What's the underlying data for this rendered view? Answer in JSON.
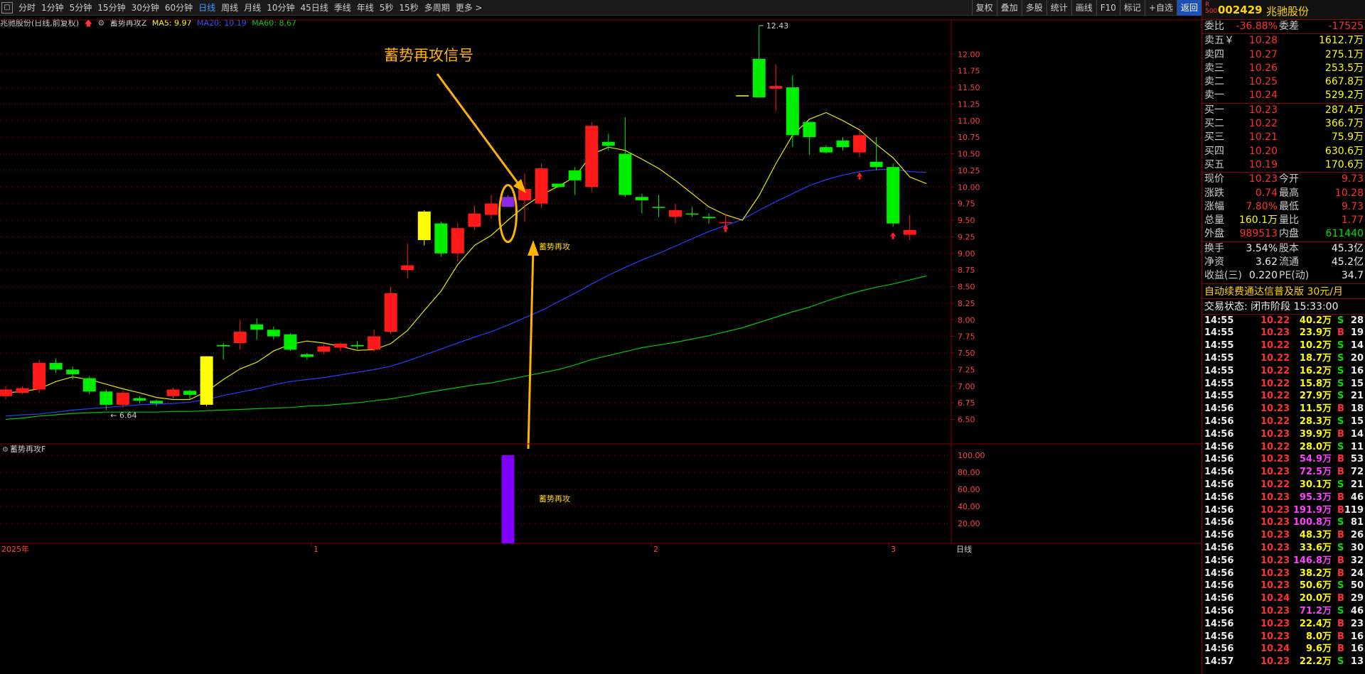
{
  "toolbar": {
    "menu_icon": "▢",
    "periods": [
      "分时",
      "1分钟",
      "5分钟",
      "15分钟",
      "30分钟",
      "60分钟",
      "日线",
      "周线",
      "月线",
      "10分钟",
      "45日线",
      "季线",
      "年线",
      "5秒",
      "15秒",
      "多周期",
      "更多 >"
    ],
    "active_period": "日线",
    "right_buttons": [
      "复权",
      "叠加",
      "多股",
      "统计",
      "画线",
      "F10",
      "标记",
      "+自选",
      "返回"
    ]
  },
  "info": {
    "title": "兆驰股份(日线,前复权)",
    "indicator": "蓄势再攻Z",
    "ma5": "MA5: 9.97",
    "ma20": "MA20: 10.19",
    "ma60": "MA60: 8.67"
  },
  "annotation": {
    "title": "蓄势再攻信号",
    "label": "蓄势再攻"
  },
  "sub_panel": {
    "title": "蓄势再攻F",
    "label": "蓄势再攻"
  },
  "bottom_axis": {
    "year": "2025年",
    "months": [
      "1",
      "2",
      "3"
    ],
    "period": "日线"
  },
  "chart_data": [
    {
      "type": "candlestick",
      "title": "兆驰股份(日线,前复权)",
      "y_ticks": [
        6.5,
        6.75,
        7.0,
        7.25,
        7.5,
        7.75,
        8.0,
        8.25,
        8.5,
        8.75,
        9.0,
        9.25,
        9.5,
        9.75,
        10.0,
        10.25,
        10.5,
        10.75,
        11.0,
        11.25,
        11.5,
        11.75,
        12.0
      ],
      "ylim": [
        6.25,
        12.6
      ],
      "max_label": "12.43",
      "min_label": "6.64",
      "candles": [
        [
          6.85,
          6.95,
          6.8,
          7.0,
          "red"
        ],
        [
          6.9,
          6.97,
          6.88,
          7.0,
          "red"
        ],
        [
          6.95,
          7.35,
          6.9,
          7.4,
          "red"
        ],
        [
          7.35,
          7.25,
          7.2,
          7.42,
          "green"
        ],
        [
          7.25,
          7.18,
          7.1,
          7.3,
          "green"
        ],
        [
          7.12,
          6.92,
          6.88,
          7.15,
          "green"
        ],
        [
          6.92,
          6.72,
          6.64,
          6.95,
          "green"
        ],
        [
          6.72,
          6.9,
          6.68,
          6.93,
          "red"
        ],
        [
          6.82,
          6.78,
          6.74,
          6.85,
          "green"
        ],
        [
          6.78,
          6.74,
          6.7,
          6.8,
          "green"
        ],
        [
          6.85,
          6.95,
          6.82,
          6.98,
          "red"
        ],
        [
          6.93,
          6.87,
          6.81,
          6.95,
          "green"
        ],
        [
          6.72,
          7.45,
          6.7,
          7.45,
          "yellow"
        ],
        [
          7.6,
          7.62,
          7.4,
          7.65,
          "green"
        ],
        [
          7.65,
          7.82,
          7.55,
          8.0,
          "red"
        ],
        [
          7.93,
          7.85,
          7.7,
          8.02,
          "green"
        ],
        [
          7.85,
          7.75,
          7.7,
          7.9,
          "green"
        ],
        [
          7.78,
          7.55,
          7.53,
          7.8,
          "green"
        ],
        [
          7.48,
          7.44,
          7.4,
          7.5,
          "green"
        ],
        [
          7.52,
          7.6,
          7.48,
          7.63,
          "red"
        ],
        [
          7.58,
          7.64,
          7.53,
          7.66,
          "red"
        ],
        [
          7.62,
          7.6,
          7.56,
          7.68,
          "green"
        ],
        [
          7.55,
          7.75,
          7.52,
          7.85,
          "red"
        ],
        [
          7.82,
          8.4,
          7.78,
          8.5,
          "red"
        ],
        [
          8.75,
          8.82,
          8.62,
          9.15,
          "red"
        ],
        [
          9.2,
          9.63,
          9.12,
          9.65,
          "yellow"
        ],
        [
          9.45,
          9.0,
          8.95,
          9.48,
          "green"
        ],
        [
          9.0,
          9.38,
          8.88,
          9.45,
          "red"
        ],
        [
          9.4,
          9.6,
          9.35,
          9.72,
          "red"
        ],
        [
          9.58,
          9.75,
          9.52,
          9.88,
          "red"
        ],
        [
          9.85,
          9.7,
          9.7,
          9.88,
          "purple"
        ],
        [
          9.8,
          9.97,
          9.48,
          10.2,
          "red"
        ],
        [
          9.75,
          10.28,
          9.68,
          10.35,
          "red"
        ],
        [
          10.05,
          10.0,
          9.98,
          10.05,
          "green"
        ],
        [
          10.1,
          10.25,
          9.88,
          10.3,
          "green"
        ],
        [
          10.0,
          10.92,
          9.92,
          10.98,
          "red"
        ],
        [
          10.68,
          10.62,
          10.55,
          10.8,
          "green"
        ],
        [
          10.5,
          9.88,
          9.85,
          11.05,
          "green"
        ],
        [
          9.85,
          9.8,
          9.6,
          9.9,
          "green"
        ],
        [
          9.7,
          9.7,
          9.55,
          9.88,
          "green"
        ],
        [
          9.55,
          9.65,
          9.45,
          9.75,
          "red"
        ],
        [
          9.6,
          9.6,
          9.55,
          9.7,
          "green"
        ],
        [
          9.53,
          9.55,
          9.45,
          9.6,
          "green"
        ],
        [
          9.47,
          9.47,
          9.4,
          9.6,
          "red"
        ],
        [
          11.38,
          11.38,
          11.38,
          11.38,
          "yellow"
        ],
        [
          11.35,
          11.93,
          11.35,
          12.43,
          "green"
        ],
        [
          11.52,
          11.48,
          11.15,
          11.85,
          "red"
        ],
        [
          11.5,
          10.78,
          10.6,
          11.68,
          "green"
        ],
        [
          10.98,
          10.75,
          10.48,
          10.98,
          "green"
        ],
        [
          10.52,
          10.6,
          10.5,
          10.63,
          "green"
        ],
        [
          10.6,
          10.7,
          10.55,
          10.75,
          "green"
        ],
        [
          10.78,
          10.52,
          10.45,
          10.85,
          "red"
        ],
        [
          10.38,
          10.3,
          10.25,
          10.75,
          "green"
        ],
        [
          10.3,
          9.45,
          9.4,
          10.35,
          "green"
        ],
        [
          9.28,
          9.35,
          9.2,
          9.58,
          "red"
        ]
      ],
      "ma5": [
        6.9,
        6.92,
        6.96,
        7.07,
        7.14,
        7.1,
        7.03,
        6.96,
        6.9,
        6.83,
        6.8,
        6.8,
        6.92,
        7.1,
        7.26,
        7.36,
        7.53,
        7.63,
        7.68,
        7.65,
        7.6,
        7.54,
        7.55,
        7.64,
        7.84,
        8.14,
        8.43,
        8.83,
        9.12,
        9.27,
        9.5,
        9.71,
        9.88,
        10.01,
        10.15,
        10.49,
        10.6,
        10.55,
        10.42,
        10.28,
        10.1,
        9.9,
        9.7,
        9.58,
        9.5,
        9.87,
        10.35,
        10.78,
        11.02,
        11.12,
        11.0,
        10.86,
        10.64,
        10.44,
        10.15,
        10.05
      ],
      "ma20": [
        6.55,
        6.57,
        6.58,
        6.61,
        6.64,
        6.66,
        6.68,
        6.7,
        6.72,
        6.73,
        6.74,
        6.76,
        6.8,
        6.86,
        6.91,
        6.96,
        7.02,
        7.07,
        7.1,
        7.13,
        7.17,
        7.21,
        7.25,
        7.3,
        7.38,
        7.47,
        7.56,
        7.65,
        7.74,
        7.82,
        7.92,
        8.03,
        8.14,
        8.27,
        8.4,
        8.54,
        8.67,
        8.79,
        8.9,
        9.0,
        9.11,
        9.22,
        9.33,
        9.42,
        9.51,
        9.65,
        9.78,
        9.9,
        10.02,
        10.11,
        10.18,
        10.23,
        10.26,
        10.27,
        10.23,
        10.22
      ],
      "ma60": [
        6.5,
        6.52,
        6.55,
        6.57,
        6.59,
        6.6,
        6.61,
        6.61,
        6.61,
        6.61,
        6.62,
        6.62,
        6.63,
        6.64,
        6.65,
        6.66,
        6.67,
        6.68,
        6.7,
        6.71,
        6.73,
        6.75,
        6.78,
        6.81,
        6.85,
        6.9,
        6.94,
        6.98,
        7.02,
        7.05,
        7.1,
        7.15,
        7.2,
        7.25,
        7.32,
        7.4,
        7.46,
        7.52,
        7.58,
        7.62,
        7.66,
        7.71,
        7.76,
        7.82,
        7.88,
        7.96,
        8.04,
        8.12,
        8.19,
        8.28,
        8.36,
        8.43,
        8.49,
        8.54,
        8.6,
        8.66
      ]
    },
    {
      "type": "bar",
      "title": "蓄势再攻F",
      "y_ticks": [
        20.0,
        40.0,
        60.0,
        80.0,
        100.0
      ],
      "ylim": [
        0,
        105
      ],
      "signal_index": 30,
      "value": 100
    }
  ],
  "quote": {
    "code": "002429",
    "name": "兆驰股份",
    "logo": "R\n500",
    "weibi": [
      "委比",
      "-36.88%",
      "委差",
      "-17525"
    ],
    "sells": [
      [
        "卖五￥",
        "10.28",
        "1612.7万"
      ],
      [
        "卖四",
        "10.27",
        "275.1万"
      ],
      [
        "卖三",
        "10.26",
        "253.5万"
      ],
      [
        "卖二",
        "10.25",
        "667.8万"
      ],
      [
        "卖一",
        "10.24",
        "529.2万"
      ]
    ],
    "buys": [
      [
        "买一",
        "10.23",
        "287.4万"
      ],
      [
        "买二",
        "10.22",
        "366.7万"
      ],
      [
        "买三",
        "10.21",
        "75.9万"
      ],
      [
        "买四",
        "10.20",
        "630.6万"
      ],
      [
        "买五",
        "10.19",
        "170.6万"
      ]
    ],
    "stats": [
      [
        "现价",
        "10.23",
        "今开",
        "9.73",
        "red",
        "red"
      ],
      [
        "涨跌",
        "0.74",
        "最高",
        "10.28",
        "red",
        "red"
      ],
      [
        "涨幅",
        "7.80%",
        "最低",
        "9.73",
        "red",
        "red"
      ],
      [
        "总量",
        "160.1万",
        "量比",
        "1.77",
        "yellow",
        "red"
      ],
      [
        "外盘",
        "989513",
        "内盘",
        "611440",
        "red",
        "green"
      ]
    ],
    "stats2": [
      [
        "换手",
        "3.54%",
        "股本",
        "45.3亿"
      ],
      [
        "净资",
        "3.62",
        "流通",
        "45.2亿"
      ],
      [
        "收益(三)",
        "0.220",
        "PE(动)",
        "34.7"
      ]
    ],
    "promo": "自动续费通达信普及版  30元/月",
    "state": "交易状态: 闭市阶段 15:33:00",
    "ticks": [
      [
        "14:55",
        "10.22",
        "40.2万",
        "S",
        "28",
        "g"
      ],
      [
        "14:55",
        "10.23",
        "23.9万",
        "B",
        "19",
        "r"
      ],
      [
        "14:55",
        "10.22",
        "10.2万",
        "S",
        "14",
        "g"
      ],
      [
        "14:55",
        "10.22",
        "18.7万",
        "S",
        "20",
        "g"
      ],
      [
        "14:55",
        "10.22",
        "16.2万",
        "S",
        "16",
        "g"
      ],
      [
        "14:55",
        "10.22",
        "15.8万",
        "S",
        "15",
        "g"
      ],
      [
        "14:55",
        "10.22",
        "27.9万",
        "S",
        "21",
        "g"
      ],
      [
        "14:56",
        "10.23",
        "11.5万",
        "B",
        "18",
        "r"
      ],
      [
        "14:56",
        "10.22",
        "28.3万",
        "S",
        "15",
        "g"
      ],
      [
        "14:56",
        "10.23",
        "39.9万",
        "B",
        "14",
        "r"
      ],
      [
        "14:56",
        "10.22",
        "28.0万",
        "S",
        "11",
        "g"
      ],
      [
        "14:56",
        "10.23",
        "54.9万",
        "B",
        "53",
        "rm"
      ],
      [
        "14:56",
        "10.23",
        "72.5万",
        "B",
        "72",
        "rm"
      ],
      [
        "14:56",
        "10.22",
        "30.1万",
        "S",
        "21",
        "g"
      ],
      [
        "14:56",
        "10.23",
        "95.3万",
        "B",
        "46",
        "rm"
      ],
      [
        "14:56",
        "10.23",
        "191.9万",
        "B",
        "119",
        "rm"
      ],
      [
        "14:56",
        "10.23",
        "100.8万",
        "S",
        "81",
        "gm"
      ],
      [
        "14:56",
        "10.23",
        "48.3万",
        "B",
        "26",
        "r"
      ],
      [
        "14:56",
        "10.23",
        "33.6万",
        "S",
        "30",
        "g"
      ],
      [
        "14:56",
        "10.23",
        "146.8万",
        "B",
        "32",
        "rm"
      ],
      [
        "14:56",
        "10.23",
        "38.2万",
        "B",
        "24",
        "r"
      ],
      [
        "14:56",
        "10.23",
        "50.6万",
        "S",
        "50",
        "g"
      ],
      [
        "14:56",
        "10.24",
        "20.0万",
        "B",
        "29",
        "r"
      ],
      [
        "14:56",
        "10.23",
        "71.2万",
        "S",
        "46",
        "gm"
      ],
      [
        "14:56",
        "10.23",
        "22.4万",
        "B",
        "23",
        "r"
      ],
      [
        "14:56",
        "10.23",
        "8.0万",
        "B",
        "16",
        "r"
      ],
      [
        "14:56",
        "10.24",
        "9.6万",
        "B",
        "16",
        "r"
      ],
      [
        "14:57",
        "10.23",
        "22.2万",
        "S",
        "13",
        "g"
      ]
    ]
  }
}
